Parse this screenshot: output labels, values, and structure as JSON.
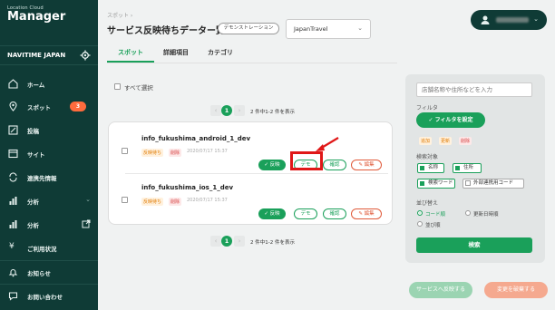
{
  "sidebar": {
    "logo_small": "Location Cloud",
    "logo_big": "Manager",
    "org_name": "NAVITIME JAPAN",
    "items": [
      {
        "label": "ホーム",
        "icon": "home-icon"
      },
      {
        "label": "スポット",
        "icon": "pin-icon",
        "badge": "3"
      },
      {
        "label": "投稿",
        "icon": "edit-icon"
      },
      {
        "label": "サイト",
        "icon": "window-icon"
      },
      {
        "label": "連携先情報",
        "icon": "sync-icon"
      },
      {
        "label": "分析",
        "icon": "chart-icon"
      },
      {
        "label": "分析",
        "icon": "chart-icon"
      },
      {
        "label": "ご利用状況",
        "icon": "yen-icon"
      },
      {
        "label": "お知らせ",
        "icon": "bell-icon"
      },
      {
        "label": "お問い合わせ",
        "icon": "chat-icon"
      }
    ]
  },
  "header": {
    "breadcrumb": "スポット ›",
    "title": "サービス反映待ちデーター覧",
    "demo_badge": "デモンストレーション",
    "project": "JapanTravel"
  },
  "tabs": [
    {
      "label": "スポット",
      "active": true
    },
    {
      "label": "詳細項目",
      "active": false
    },
    {
      "label": "カテゴリ",
      "active": false
    }
  ],
  "list": {
    "select_all": "すべて選択",
    "pager": {
      "prev": "‹",
      "page": "1",
      "next": "›",
      "info": "2 件中1-2 件を表示"
    },
    "rows": [
      {
        "name": "info_fukushima_android_1_dev",
        "tag_pending": "反映待ち",
        "tag_delete": "削除",
        "date": "2020/07/17 15:37"
      },
      {
        "name": "info_fukushima_ios_1_dev",
        "tag_pending": "反映待ち",
        "tag_delete": "削除",
        "date": "2020/07/17 15:37"
      }
    ],
    "actions": {
      "reflect": "✓ 反映",
      "demo": "デモ",
      "confirm": "確認",
      "edit": "✎ 編集"
    }
  },
  "filter_panel": {
    "search_placeholder": "店舗名称や住所などを入力",
    "filter_label": "フィルタ",
    "filter_button": "✓ フィルタを設定",
    "tags": {
      "pending": "追加",
      "update": "更新",
      "delete": "削除"
    },
    "target_label": "検索対象",
    "targets": {
      "name": "名称",
      "address": "住所",
      "keyword": "検索ワード",
      "external": "外部連携用コード"
    },
    "sort_label": "並び替え",
    "sort": {
      "code": "コード順",
      "updated": "更新日時順",
      "order": "並び順"
    },
    "search_button": "検索"
  },
  "bottom": {
    "reflect_service": "サービスへ反映する",
    "cancel_change": "変更を破棄する"
  },
  "colors": {
    "accent": "#1aa05a",
    "sidebar": "#0f3b36",
    "highlight": "#e01818"
  }
}
